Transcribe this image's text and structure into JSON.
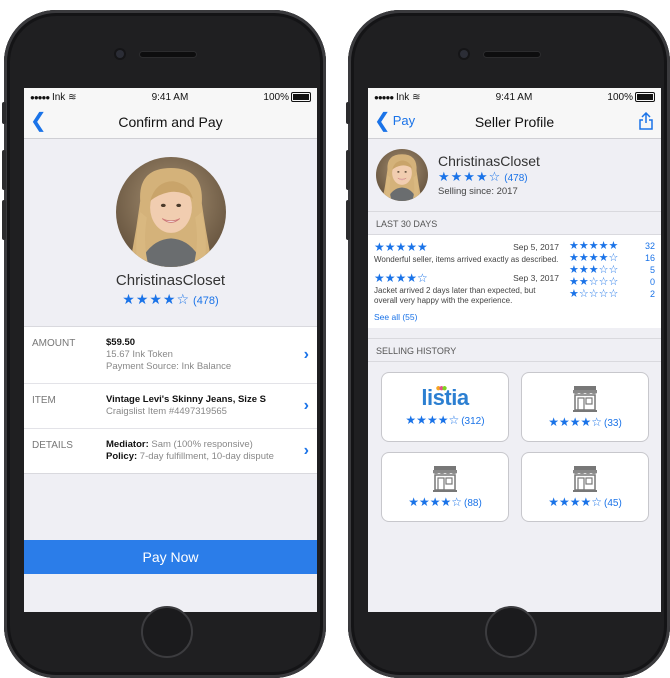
{
  "status": {
    "carrier": "Ink",
    "time": "9:41 AM",
    "battery": "100%"
  },
  "left": {
    "nav_title": "Confirm and Pay",
    "seller_name": "ChristinasCloset",
    "stars": "★★★★☆",
    "rating_count": "(478)",
    "rows": [
      {
        "label": "AMOUNT",
        "line1": "$59.50",
        "line2": "15.67 Ink Token",
        "line3": "Payment Source: Ink Balance"
      },
      {
        "label": "ITEM",
        "line1": "Vintage Levi's Skinny Jeans, Size S",
        "line2": "Craigslist Item #4497319565"
      },
      {
        "label": "DETAILS",
        "k1": "Mediator:",
        "v1": " Sam (100% responsive)",
        "k2": "Policy:",
        "v2": " 7-day fulfillment, 10-day dispute"
      }
    ],
    "pay_button": "Pay Now"
  },
  "right": {
    "back_label": "Pay",
    "nav_title": "Seller Profile",
    "seller_name": "ChristinasCloset",
    "stars": "★★★★☆",
    "rating_count": "(478)",
    "selling_since": "Selling since: 2017",
    "last30_header": "LAST 30 DAYS",
    "reviews": [
      {
        "stars": "★★★★★",
        "date": "Sep 5, 2017",
        "text": "Wonderful seller, items arrived exactly as described."
      },
      {
        "stars": "★★★★☆",
        "date": "Sep 3, 2017",
        "text": "Jacket arrived 2 days later than expected, but overall very happy with the experience."
      }
    ],
    "see_all": "See all (55)",
    "distribution": [
      {
        "stars": "★★★★★",
        "count": "32"
      },
      {
        "stars": "★★★★☆",
        "count": "16"
      },
      {
        "stars": "★★★☆☆",
        "count": "5"
      },
      {
        "stars": "★★☆☆☆",
        "count": "0"
      },
      {
        "stars": "★☆☆☆☆",
        "count": "2"
      }
    ],
    "history_header": "SELLING HISTORY",
    "history": [
      {
        "logo": "listia",
        "logo_text": "listia",
        "stars": "★★★★☆",
        "count": "(312)"
      },
      {
        "logo": "store-icon",
        "stars": "★★★★☆",
        "count": "(33)"
      },
      {
        "logo": "store-icon",
        "stars": "★★★★☆",
        "count": "(88)"
      },
      {
        "logo": "store-icon",
        "stars": "★★★★☆",
        "count": "(45)"
      }
    ]
  },
  "colors": {
    "accent": "#1a73e8",
    "pay_button": "#2b7de9",
    "background": "#efeff4"
  }
}
